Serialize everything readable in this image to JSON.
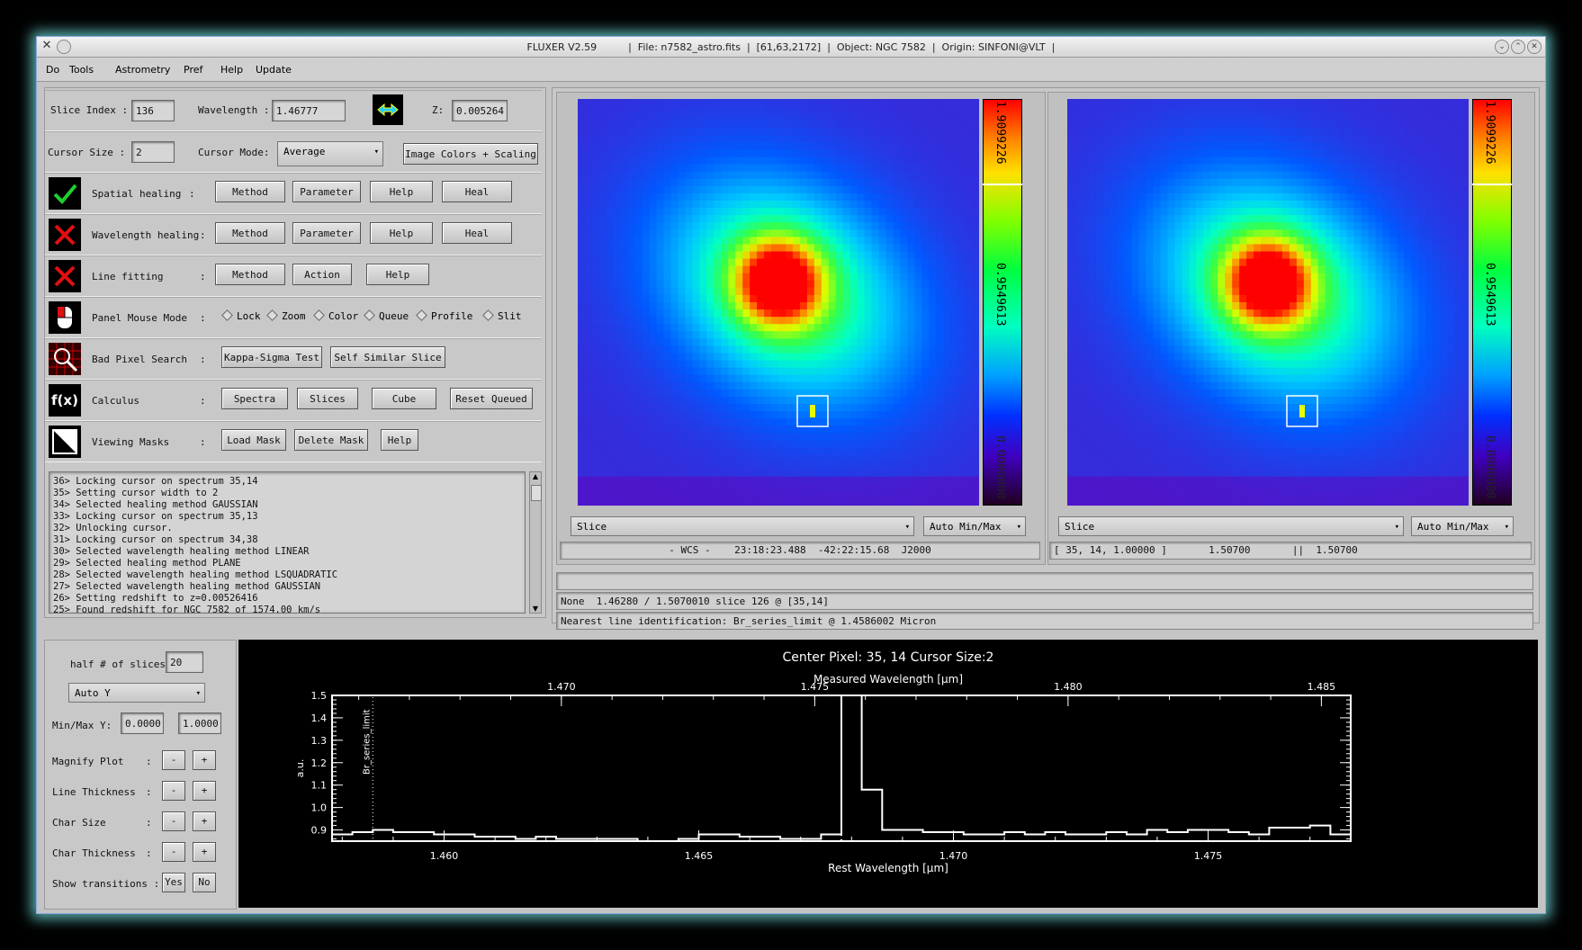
{
  "window": {
    "title": "FLUXER V2.59          |  File: n7582_astro.fits  |  [61,63,2172]  |  Object: NGC 7582  |  Origin: SINFONI@VLT  |"
  },
  "menu": [
    "Do",
    "Tools",
    "Astrometry",
    "Pref",
    "Help",
    "Update"
  ],
  "controls": {
    "slice_index_label": "Slice Index :",
    "slice_index_value": "136",
    "wavelength_label": "Wavelength :",
    "wavelength_value": "1.46777",
    "z_label": "Z:",
    "z_value": "0.005264",
    "cursor_size_label": "Cursor Size :",
    "cursor_size_value": "2",
    "cursor_mode_label": "Cursor Mode:",
    "cursor_mode_value": "Average",
    "image_colors_button": "Image Colors + Scaling"
  },
  "rows": {
    "spatial": {
      "label": "Spatial healing",
      "colon": ":",
      "buttons": [
        "Method",
        "Parameter",
        "Help",
        "Heal"
      ]
    },
    "wavelength": {
      "label": "Wavelength healing",
      "colon": ":",
      "buttons": [
        "Method",
        "Parameter",
        "Help",
        "Heal"
      ]
    },
    "linefit": {
      "label": "Line fitting",
      "colon": ":",
      "buttons": [
        "Method",
        "Action",
        "Help"
      ]
    },
    "mouse": {
      "label": "Panel Mouse Mode",
      "colon": ":",
      "options": [
        "Lock",
        "Zoom",
        "Color",
        "Queue",
        "Profile",
        "Slit"
      ]
    },
    "badpix": {
      "label": "Bad Pixel Search",
      "colon": ":",
      "buttons": [
        "Kappa-Sigma Test",
        "Self Similar Slice"
      ]
    },
    "calculus": {
      "label": "Calculus",
      "colon": ":",
      "buttons": [
        "Spectra",
        "Slices",
        "Cube",
        "Reset Queued"
      ],
      "icon_text": "f(x)"
    },
    "masks": {
      "label": "Viewing Masks",
      "colon": ":",
      "buttons": [
        "Load Mask",
        "Delete Mask",
        "Help"
      ]
    }
  },
  "log": [
    "36> Locking cursor on spectrum 35,14",
    "35> Setting cursor width to 2",
    "34> Selected healing method GAUSSIAN",
    "33> Locking cursor on spectrum 35,13",
    "32> Unlocking cursor.",
    "31> Locking cursor on spectrum 34,38",
    "30> Selected wavelength healing method LINEAR",
    "29> Selected healing method PLANE",
    "28> Selected wavelength healing method LSQUADRATIC",
    "27> Selected wavelength healing method GAUSSIAN",
    "26> Setting redshift to z=0.00526416",
    "25> Found redshift for NGC 7582 of 1574.00 km/s"
  ],
  "image_left": {
    "cbar_top": "1.9099226",
    "cbar_mid": "0.9549613",
    "cbar_bot": "0.0000000",
    "dropdown": "Slice",
    "scale": "Auto Min/Max",
    "status": "- WCS -    23:18:23.488  -42:22:15.68  J2000"
  },
  "image_right": {
    "cbar_top": "1.9099226",
    "cbar_mid": "0.9549613",
    "cbar_bot": "0.0000000",
    "dropdown": "Slice",
    "scale": "Auto Min/Max",
    "status": "[ 35, 14, 1.00000 ]       1.50700       ||  1.50700"
  },
  "status_lines": {
    "line1": "",
    "line2": "None  1.46280 / 1.5070010 slice 126 @ [35,14]",
    "line3": "Nearest line identification: Br_series_limit @ 1.4586002 Micron"
  },
  "plot_controls": {
    "half_slices_label": "half # of slices",
    "half_slices_value": "20",
    "auto_y": "Auto Y",
    "minmax_label": "Min/Max Y:",
    "min_value": "0.0000",
    "max_value": "1.0000",
    "magnify_label": "Magnify Plot",
    "line_thickness_label": "Line Thickness",
    "char_size_label": "Char Size",
    "char_thickness_label": "Char Thickness",
    "show_transitions_label": "Show transitions :",
    "colon": ":",
    "minus": "-",
    "plus": "+",
    "yes": "Yes",
    "no": "No"
  },
  "chart_data": {
    "type": "line",
    "title": "Center Pixel: 35, 14   Cursor Size:2",
    "xlabel": "Rest Wavelength [μm]",
    "x2label": "Measured Wavelength [μm]",
    "ylabel": "a.u.",
    "xlim": [
      1.4578,
      1.4778
    ],
    "ylim": [
      0.85,
      1.5
    ],
    "xticks": [
      "1.460",
      "1.465",
      "1.470",
      "1.475"
    ],
    "x2ticks": [
      "1.470",
      "1.475",
      "1.480",
      "1.485"
    ],
    "yticks": [
      "0.9",
      "1.0",
      "1.1",
      "1.2",
      "1.3",
      "1.4",
      "1.5"
    ],
    "annotation": "Br_series_limit",
    "annotation_x": 1.4586,
    "marker_x": 1.4678,
    "x": [
      1.4578,
      1.4582,
      1.4586,
      1.459,
      1.4594,
      1.4598,
      1.4602,
      1.4606,
      1.461,
      1.4614,
      1.4618,
      1.4622,
      1.4626,
      1.463,
      1.4634,
      1.4638,
      1.4642,
      1.4646,
      1.465,
      1.4654,
      1.4658,
      1.4662,
      1.4666,
      1.467,
      1.4674,
      1.4678,
      1.4682,
      1.4686,
      1.469,
      1.4694,
      1.4698,
      1.4702,
      1.4706,
      1.471,
      1.4714,
      1.4718,
      1.4722,
      1.4726,
      1.473,
      1.4734,
      1.4738,
      1.4742,
      1.4746,
      1.475,
      1.4754,
      1.4758,
      1.4762,
      1.4766,
      1.477,
      1.4774
    ],
    "y": [
      0.88,
      0.89,
      0.9,
      0.89,
      0.89,
      0.88,
      0.88,
      0.87,
      0.87,
      0.86,
      0.87,
      0.86,
      0.86,
      0.86,
      0.86,
      0.85,
      0.85,
      0.86,
      0.88,
      0.88,
      0.87,
      0.87,
      0.86,
      0.86,
      0.88,
      1.5,
      1.08,
      0.9,
      0.9,
      0.89,
      0.89,
      0.88,
      0.88,
      0.89,
      0.88,
      0.89,
      0.88,
      0.88,
      0.89,
      0.88,
      0.9,
      0.89,
      0.9,
      0.9,
      0.89,
      0.88,
      0.91,
      0.91,
      0.92,
      0.88
    ]
  }
}
